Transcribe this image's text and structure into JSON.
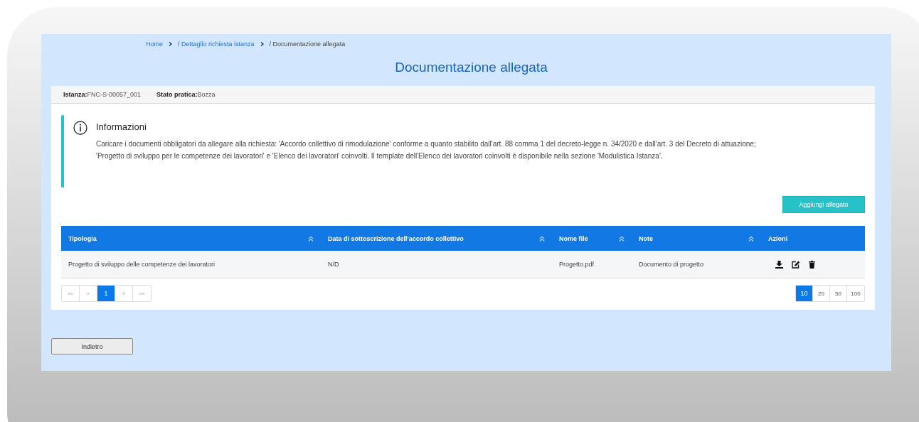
{
  "breadcrumb": [
    {
      "label": "Home",
      "link": true
    },
    {
      "label": "/ Dettaglio richiesta istanza",
      "link": true
    },
    {
      "label": "/ Documentazione allegata",
      "link": false
    }
  ],
  "title": "Documentazione allegata",
  "summary": [
    {
      "label": "Istanza:",
      "value": "FNC-S-00057_001"
    },
    {
      "label": "Stato pratica:",
      "value": "Bozza"
    }
  ],
  "info": {
    "title": "Informazioni",
    "text": "Caricare i documenti obbligatori da allegare alla richiesta: 'Accordo collettivo di rimodulazione' conforme a quanto stabilito dall'art. 88 comma 1 del decreto-legge n. 34/2020 e dall'art. 3 del Decreto di attuazione; 'Progetto di sviluppo per le competenze dei lavoratori' e 'Elenco dei lavoratori' coinvolti. Il template dell'Elenco dei lavoratori coinvolti è disponibile nella sezione 'Modulistica Istanza'."
  },
  "add_button": "Aggiungi allegato",
  "table": {
    "columns": [
      {
        "label": "Tipologia",
        "sortable": true
      },
      {
        "label": "Data di sottoscrizione dell'accordo collettivo",
        "sortable": true
      },
      {
        "label": "Nome file",
        "sortable": true
      },
      {
        "label": "Note",
        "sortable": true
      },
      {
        "label": "Azioni",
        "sortable": false
      }
    ],
    "rows": [
      {
        "cells": [
          "Progetto di sviluppo delle competenze dei lavoratori",
          "N/D",
          "Progetto.pdf",
          "Documento di progetto"
        ],
        "actions": [
          {
            "kind": "download"
          },
          {
            "kind": "edit"
          },
          {
            "kind": "delete"
          }
        ]
      }
    ]
  },
  "pagination": [
    {
      "label": "««",
      "selected": false
    },
    {
      "label": "«",
      "selected": false
    },
    {
      "label": "1",
      "selected": true
    },
    {
      "label": "»",
      "selected": false
    },
    {
      "label": "»»",
      "selected": false
    }
  ],
  "page_sizes": [
    {
      "label": "10",
      "selected": true
    },
    {
      "label": "20",
      "selected": false
    },
    {
      "label": "50",
      "selected": false
    },
    {
      "label": "100",
      "selected": false
    }
  ],
  "back_button": "Indietro"
}
